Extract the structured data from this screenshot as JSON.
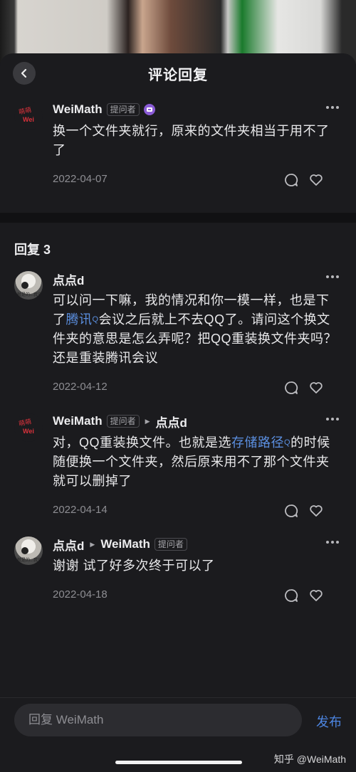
{
  "header": {
    "title": "评论回复"
  },
  "main_comment": {
    "author": "WeiMath",
    "badge": "提问者",
    "avatar_text": [
      "萌萌",
      "Wei"
    ],
    "text": "换一个文件夹就行，原来的文件夹相当于用不了了",
    "date": "2022-04-07"
  },
  "replies_header": "回复 3",
  "replies": [
    {
      "author": "点点d",
      "avatar_text": "就是的...我还",
      "text_before": "可以问一下嘛，我的情况和你一模一样，也是下了",
      "link": "腾讯",
      "text_after": "会议之后就上不去QQ了。请问这个换文件夹的意思是怎么弄呢？把QQ重装换文件夹吗？还是重装腾讯会议",
      "date": "2022-04-12"
    },
    {
      "author": "WeiMath",
      "badge": "提问者",
      "reply_to": "点点d",
      "avatar_text": [
        "萌萌",
        "Wei"
      ],
      "text_before": "对，QQ重装换文件。也就是选",
      "link": "存储路径",
      "text_after": "的时候随便换一个文件夹，然后原来用不了那个文件夹就可以删掉了",
      "date": "2022-04-14"
    },
    {
      "author": "点点d",
      "reply_to": "WeiMath",
      "reply_to_badge": "提问者",
      "avatar_text": "就是的...我还",
      "text": "谢谢 试了好多次终于可以了",
      "date": "2022-04-18"
    }
  ],
  "input": {
    "placeholder": "回复 WeiMath"
  },
  "send_label": "发布",
  "watermark": "知乎 @WeiMath",
  "link_sup": "Q",
  "colors": {
    "accent": "#4d86e2",
    "link": "#5b8fe0",
    "background": "#1b1b1e"
  }
}
